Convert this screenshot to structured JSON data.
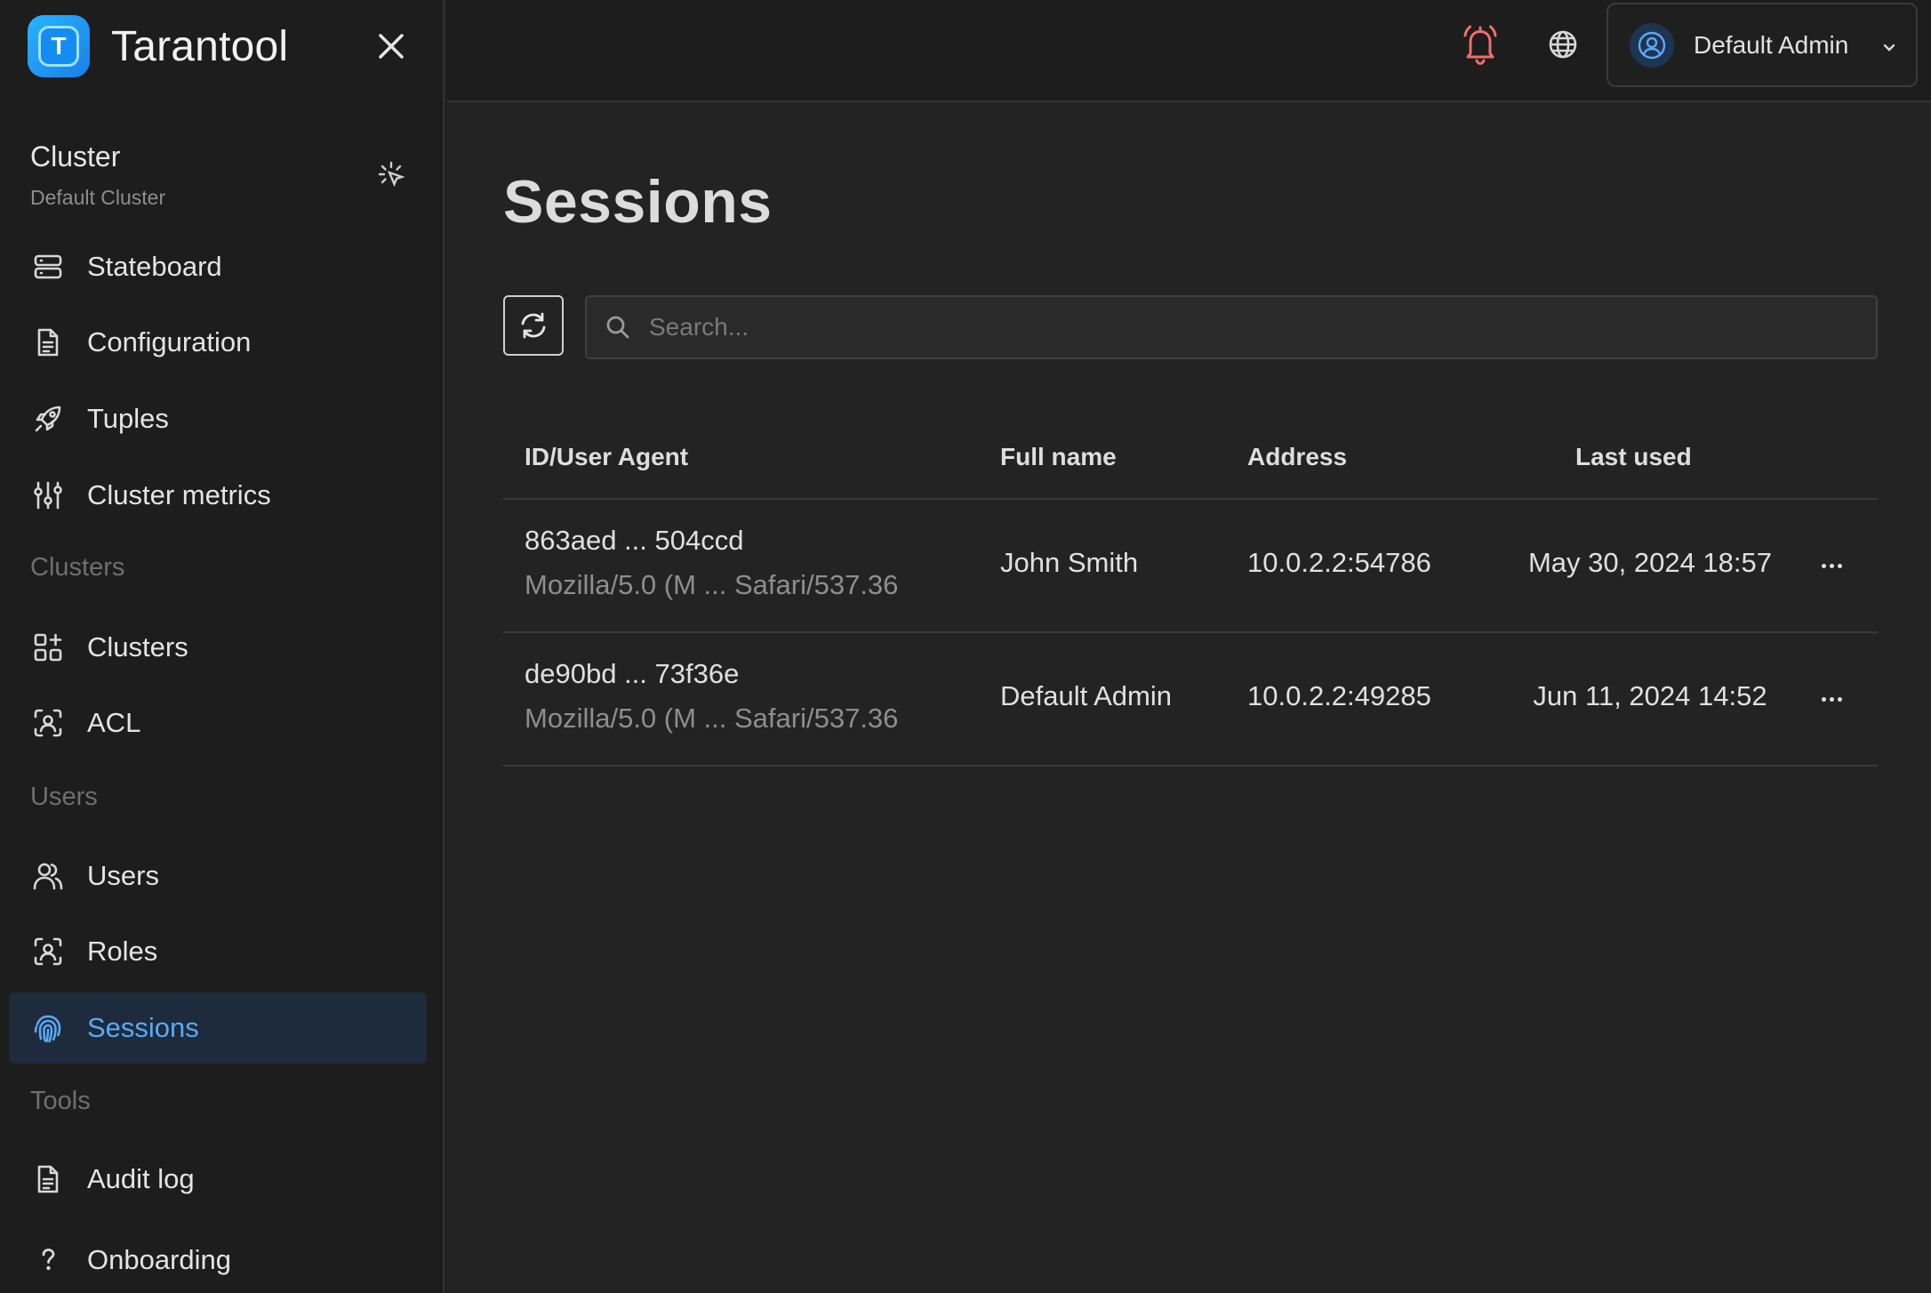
{
  "app": {
    "name": "Tarantool",
    "logo_letter": "T"
  },
  "cluster": {
    "title": "Cluster",
    "name": "Default Cluster"
  },
  "nav": {
    "items_top": [
      {
        "label": "Stateboard",
        "icon": "server-icon"
      },
      {
        "label": "Configuration",
        "icon": "document-icon"
      },
      {
        "label": "Tuples",
        "icon": "rocket-icon"
      },
      {
        "label": "Cluster metrics",
        "icon": "sliders-icon"
      }
    ],
    "section_clusters": "Clusters",
    "items_clusters": [
      {
        "label": "Clusters",
        "icon": "grid-plus-icon"
      },
      {
        "label": "ACL",
        "icon": "scan-user-icon"
      }
    ],
    "section_users": "Users",
    "items_users": [
      {
        "label": "Users",
        "icon": "users-icon"
      },
      {
        "label": "Roles",
        "icon": "scan-user-icon"
      },
      {
        "label": "Sessions",
        "icon": "fingerprint-icon",
        "active": true
      }
    ],
    "section_tools": "Tools",
    "items_tools": [
      {
        "label": "Audit log",
        "icon": "document-icon"
      },
      {
        "label": "Onboarding",
        "icon": "question-icon"
      }
    ]
  },
  "header": {
    "user_name": "Default Admin",
    "bell_color": "#f26d6d"
  },
  "page": {
    "title": "Sessions"
  },
  "search": {
    "placeholder": "Search..."
  },
  "table": {
    "headers": {
      "id": "ID/User Agent",
      "name": "Full name",
      "address": "Address",
      "last_used": "Last used"
    },
    "rows": [
      {
        "id": "863aed ... 504ccd",
        "ua": "Mozilla/5.0 (M ... Safari/537.36",
        "name": "John Smith",
        "address": "10.0.2.2:54786",
        "last_used": "May 30, 2024 18:57"
      },
      {
        "id": "de90bd ... 73f36e",
        "ua": "Mozilla/5.0 (M ... Safari/537.36",
        "name": "Default Admin",
        "address": "10.0.2.2:49285",
        "last_used": "Jun 11, 2024 14:52"
      }
    ]
  },
  "colors": {
    "accent": "#5aa9f5",
    "active_bg": "#1e2b3d"
  }
}
